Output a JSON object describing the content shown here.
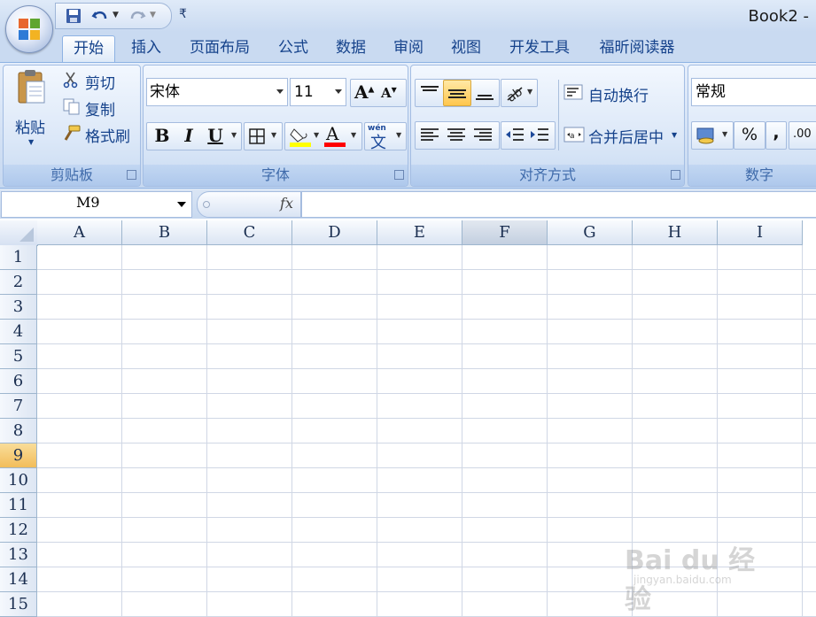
{
  "window": {
    "title": "Book2 -"
  },
  "quick_access": {
    "icons": [
      "save-icon",
      "undo-icon",
      "redo-icon",
      "customize-icon"
    ]
  },
  "tabs": [
    {
      "label": "开始",
      "active": true
    },
    {
      "label": "插入"
    },
    {
      "label": "页面布局"
    },
    {
      "label": "公式"
    },
    {
      "label": "数据"
    },
    {
      "label": "审阅"
    },
    {
      "label": "视图"
    },
    {
      "label": "开发工具"
    },
    {
      "label": "福昕阅读器"
    }
  ],
  "clipboard": {
    "group_label": "剪贴板",
    "paste_label": "粘贴",
    "cut_label": "剪切",
    "copy_label": "复制",
    "format_painter_label": "格式刷"
  },
  "font": {
    "group_label": "字体",
    "font_name": "宋体",
    "font_size": "11",
    "bold": "B",
    "italic": "I",
    "underline": "U",
    "font_color_glyph": "A",
    "phonetic_glyph": "wén",
    "phonetic_char": "文",
    "highlight_color": "#ffff00",
    "font_color": "#ff0000"
  },
  "alignment": {
    "group_label": "对齐方式",
    "wrap_text_label": "自动换行",
    "merge_center_label": "合并后居中"
  },
  "number": {
    "group_label": "数字",
    "format": "常规",
    "percent": "%",
    "comma": ",",
    "decimal_glyph": ".00"
  },
  "formula_bar": {
    "name_box": "M9",
    "fx_label": "fx",
    "formula": ""
  },
  "sheet": {
    "columns": [
      "A",
      "B",
      "C",
      "D",
      "E",
      "F",
      "G",
      "H",
      "I"
    ],
    "rows": [
      "1",
      "2",
      "3",
      "4",
      "5",
      "6",
      "7",
      "8",
      "9",
      "10",
      "11",
      "12",
      "13",
      "14",
      "15"
    ],
    "highlighted_column": "F",
    "selected_row": "9"
  },
  "watermark": {
    "text": "Bai du 经验",
    "sub": "jingyan.baidu.com"
  }
}
